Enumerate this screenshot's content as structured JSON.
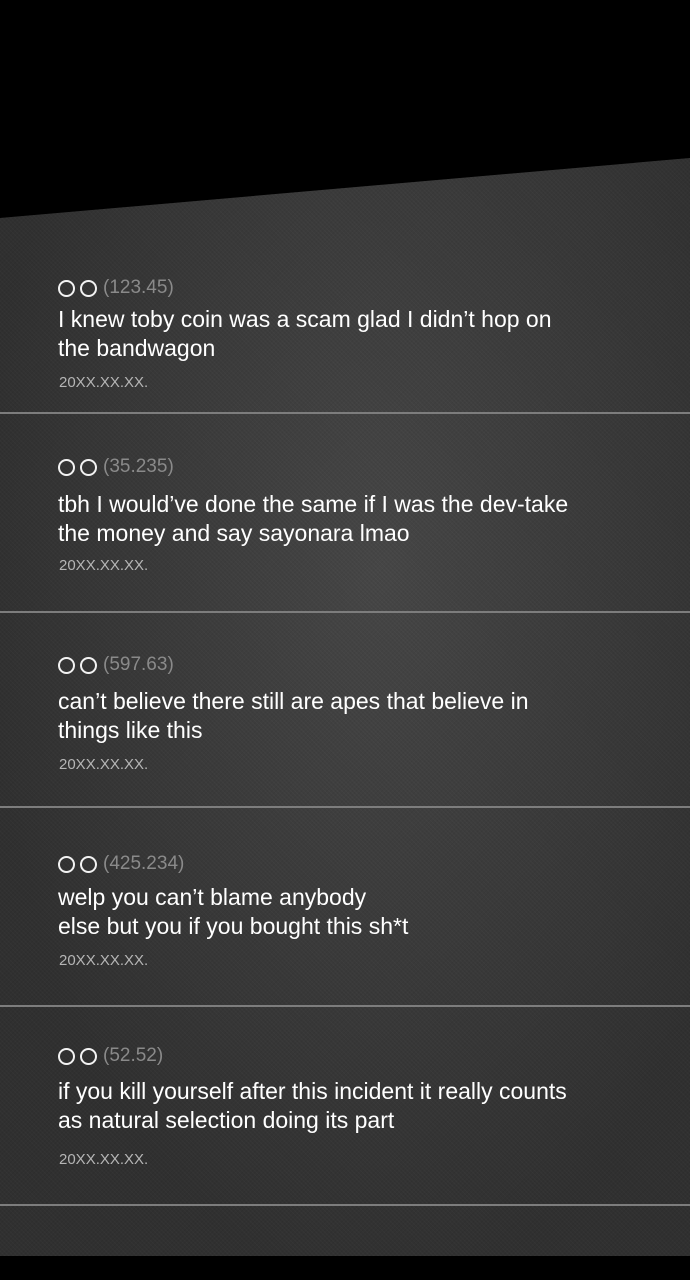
{
  "comments": [
    {
      "user_icon": "double-circle-icon",
      "score": "(123.45)",
      "text": "I knew toby coin was a scam glad I didn’t hop on\nthe bandwagon",
      "date": "20XX.XX.XX."
    },
    {
      "user_icon": "double-circle-icon",
      "score": "(35.235)",
      "text": "tbh I would’ve done the same if I was the dev-take\nthe money and say sayonara lmao",
      "date": "20XX.XX.XX."
    },
    {
      "user_icon": "double-circle-icon",
      "score": "(597.63)",
      "text": "can’t believe there still are apes that believe in\nthings like this",
      "date": "20XX.XX.XX."
    },
    {
      "user_icon": "double-circle-icon",
      "score": "(425.234)",
      "text": "welp you can’t blame anybody\nelse but you if you bought this sh*t",
      "date": "20XX.XX.XX."
    },
    {
      "user_icon": "double-circle-icon",
      "score": "(52.52)",
      "text": "if you kill yourself after this incident it really counts\nas natural selection doing its part",
      "date": "20XX.XX.XX."
    }
  ],
  "colors": {
    "background": "#000000",
    "panel": "#3a3a3a",
    "text": "#ffffff",
    "score": "#8a8a8a",
    "date": "#b5b5b5",
    "divider": "#7d7d7d"
  }
}
